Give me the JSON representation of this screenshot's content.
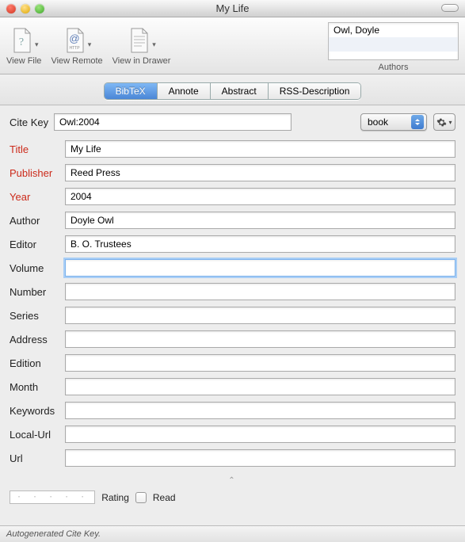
{
  "window": {
    "title": "My Life"
  },
  "toolbar": {
    "view_file": "View File",
    "view_remote": "View Remote",
    "view_drawer": "View in Drawer"
  },
  "authors": {
    "label": "Authors",
    "list": [
      "Owl, Doyle"
    ]
  },
  "tabs": [
    {
      "label": "BibTeX",
      "active": true
    },
    {
      "label": "Annote",
      "active": false
    },
    {
      "label": "Abstract",
      "active": false
    },
    {
      "label": "RSS-Description",
      "active": false
    }
  ],
  "citekey": {
    "label": "Cite Key",
    "value": "Owl:2004"
  },
  "type_select": {
    "value": "book"
  },
  "fields": {
    "title": {
      "label": "Title",
      "value": "My Life",
      "required": true
    },
    "publisher": {
      "label": "Publisher",
      "value": "Reed Press",
      "required": true
    },
    "year": {
      "label": "Year",
      "value": "2004",
      "required": true
    },
    "author": {
      "label": "Author",
      "value": "Doyle Owl",
      "required": false
    },
    "editor": {
      "label": "Editor",
      "value": "B. O. Trustees",
      "required": false
    },
    "volume": {
      "label": "Volume",
      "value": "",
      "required": false,
      "focused": true
    },
    "number": {
      "label": "Number",
      "value": "",
      "required": false
    },
    "series": {
      "label": "Series",
      "value": "",
      "required": false
    },
    "address": {
      "label": "Address",
      "value": "",
      "required": false
    },
    "edition": {
      "label": "Edition",
      "value": "",
      "required": false
    },
    "month": {
      "label": "Month",
      "value": "",
      "required": false
    },
    "keywords": {
      "label": "Keywords",
      "value": "",
      "required": false
    },
    "localurl": {
      "label": "Local-Url",
      "value": "",
      "required": false
    },
    "url": {
      "label": "Url",
      "value": "",
      "required": false
    }
  },
  "bottom": {
    "rating_label": "Rating",
    "rating_dots": "· · · · ·",
    "read_label": "Read",
    "read_checked": false
  },
  "status": "Autogenerated Cite Key."
}
